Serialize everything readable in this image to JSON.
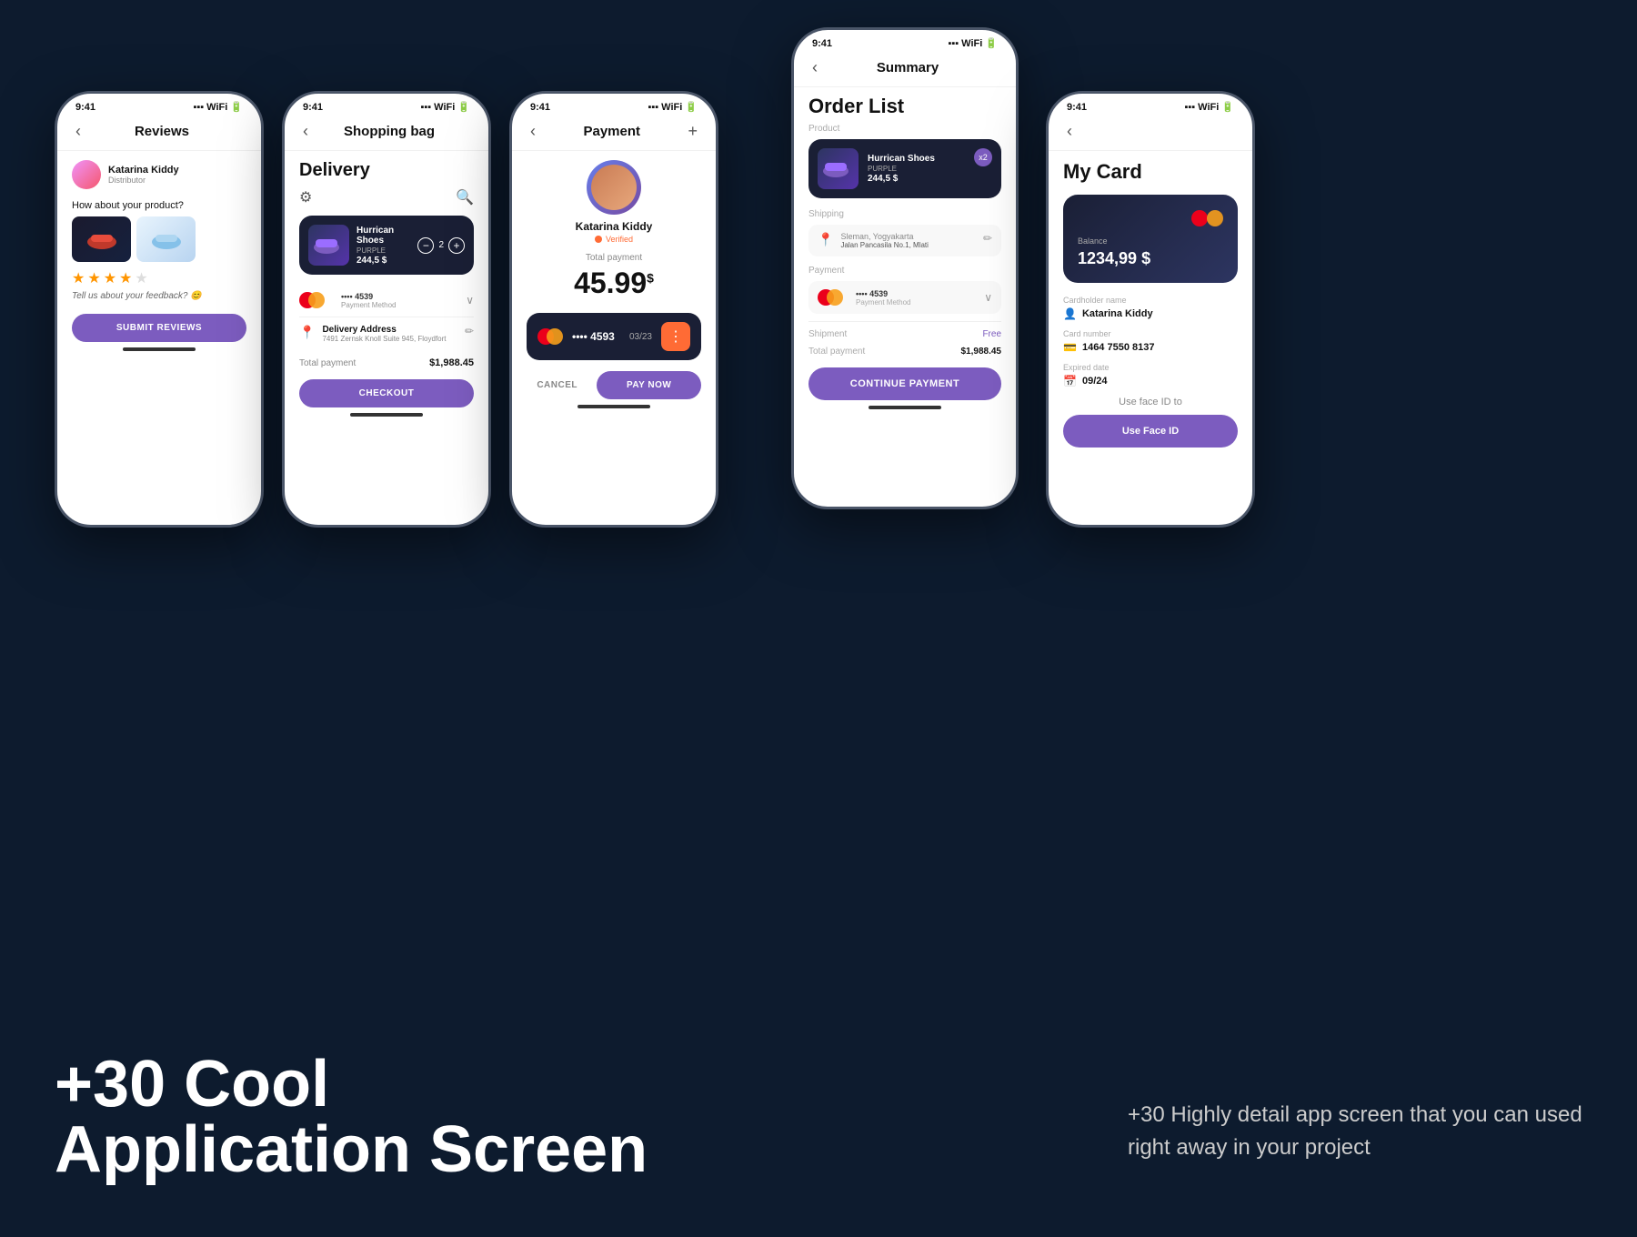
{
  "app": {
    "background": "#0d1b2e"
  },
  "phone1": {
    "status_time": "9:41",
    "header_title": "Reviews",
    "reviewer_name": "Katarina Kiddy",
    "reviewer_role": "Distributor",
    "review_question": "How about your product?",
    "stars": [
      true,
      true,
      true,
      true,
      false
    ],
    "feedback": "Tell us about your feedback? 😊",
    "submit_btn": "SUBMIT REVIEWS"
  },
  "phone2": {
    "status_time": "9:41",
    "header_title": "Shopping bag",
    "delivery_title": "Delivery",
    "product_name": "Hurrican Shoes",
    "product_variant": "PURPLE",
    "product_price": "244,5 $",
    "product_qty": "2",
    "payment_card": "•••• 4539",
    "payment_method": "Payment Method",
    "delivery_address_title": "Delivery Address",
    "delivery_address": "7491 Zernsk Knoll Suite 945, Floydfort",
    "total_label": "Total payment",
    "total_value": "$1,988.45",
    "checkout_btn": "CHECKOUT"
  },
  "phone3": {
    "status_time": "9:41",
    "header_title": "Payment",
    "user_name": "Katarina Kiddy",
    "verified_text": "Verified",
    "total_payment_label": "Total payment",
    "big_price": "45.99",
    "currency": "$",
    "card_number": "4593",
    "card_expiry": "03/23",
    "cancel_btn": "CANCEL",
    "pay_now_btn": "PAY NOW"
  },
  "phone4": {
    "status_time": "9:41",
    "header_title": "Summary",
    "order_list_title": "Order List",
    "product_section": "Product",
    "product_name": "Hurrican Shoes",
    "product_variant": "PURPLE",
    "product_price": "244,5 $",
    "product_qty": "x2",
    "shipping_section": "Shipping",
    "shipping_city": "Sleman, Yogyakarta",
    "shipping_address": "Jalan Pancasila No.1, Mlati",
    "payment_section": "Payment",
    "payment_card": "•••• 4539",
    "payment_method": "Payment Method",
    "shipment_label": "Shipment",
    "shipment_value": "Free",
    "total_label": "Total payment",
    "total_value": "$1,988.45",
    "continue_btn": "CONTINUE PAYMENT"
  },
  "phone5": {
    "status_time": "9:41",
    "title": "My Card",
    "balance_label": "Balance",
    "balance_value": "1234,99 $",
    "cardholder_label": "Cardholder name",
    "cardholder_value": "Katarina Kiddy",
    "card_number_label": "Card number",
    "card_number_value": "1464 7550 8137",
    "expired_label": "Expired date",
    "expired_value": "09/24",
    "face_id_label": "Use face ID to",
    "face_id_btn": "Use Face ID"
  },
  "bottom": {
    "heading_line1": "+30 Cool",
    "heading_line2": "Application Screen",
    "description": "+30 Highly detail app screen that you can used right away in your project"
  }
}
